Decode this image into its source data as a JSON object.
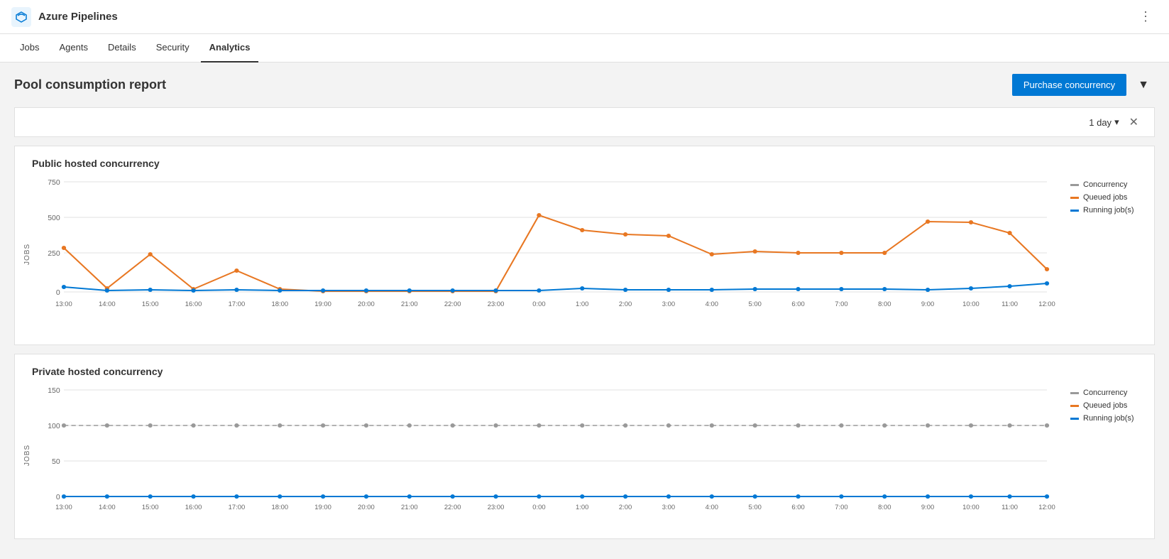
{
  "app": {
    "title": "Azure Pipelines",
    "logo_icon": "cloud-icon"
  },
  "nav": {
    "items": [
      {
        "id": "jobs",
        "label": "Jobs",
        "active": false
      },
      {
        "id": "agents",
        "label": "Agents",
        "active": false
      },
      {
        "id": "details",
        "label": "Details",
        "active": false
      },
      {
        "id": "security",
        "label": "Security",
        "active": false
      },
      {
        "id": "analytics",
        "label": "Analytics",
        "active": true
      }
    ]
  },
  "page": {
    "title": "Pool consumption report",
    "purchase_btn": "Purchase concurrency",
    "filter_label": "1 day"
  },
  "charts": {
    "public": {
      "title": "Public hosted concurrency",
      "y_label": "JOBS",
      "y_ticks": [
        0,
        250,
        500,
        750
      ],
      "legend": {
        "concurrency": "Concurrency",
        "queued": "Queued jobs",
        "running": "Running job(s)"
      }
    },
    "private": {
      "title": "Private hosted concurrency",
      "y_label": "JOBS",
      "y_ticks": [
        0,
        50,
        100,
        150
      ],
      "legend": {
        "concurrency": "Concurrency",
        "queued": "Queued jobs",
        "running": "Running job(s)"
      }
    }
  },
  "time_labels": [
    "13:00",
    "14:00",
    "15:00",
    "16:00",
    "17:00",
    "18:00",
    "19:00",
    "20:00",
    "21:00",
    "22:00",
    "23:00",
    "0:00",
    "1:00",
    "2:00",
    "3:00",
    "4:00",
    "5:00",
    "6:00",
    "7:00",
    "8:00",
    "9:00",
    "10:00",
    "11:00",
    "12:00"
  ]
}
